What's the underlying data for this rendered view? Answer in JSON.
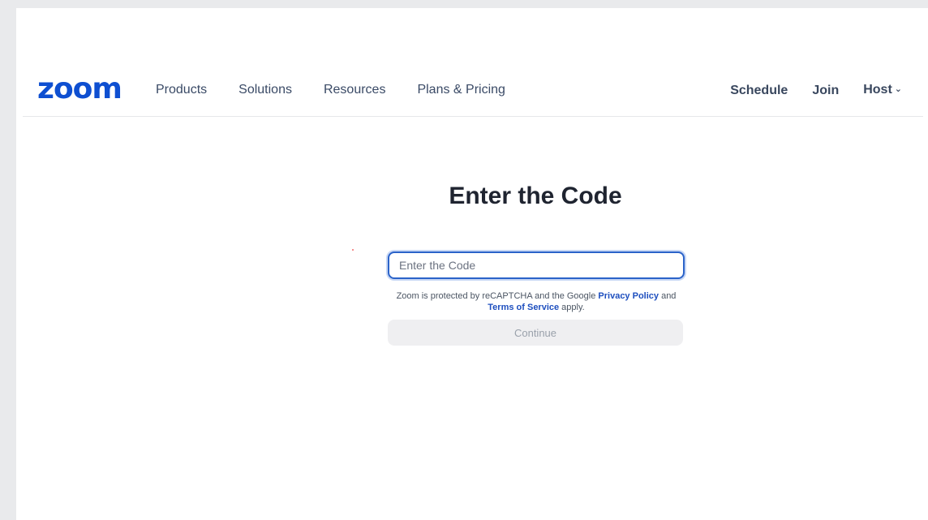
{
  "brand": {
    "logo_text": "zoom",
    "color": "#0e4fd1"
  },
  "nav": {
    "left": [
      "Products",
      "Solutions",
      "Resources",
      "Plans & Pricing"
    ],
    "right": {
      "schedule": "Schedule",
      "join": "Join",
      "host": "Host",
      "host_icon": "chevron-down-icon"
    }
  },
  "main": {
    "title": "Enter the Code",
    "input_placeholder": "Enter the Code",
    "input_value": "",
    "recaptcha": {
      "text_before": "Zoom is protected by reCAPTCHA and the Google ",
      "privacy_link": "Privacy Policy",
      "and_text": " and ",
      "terms_link": "Terms of Service",
      "text_after": " apply."
    },
    "continue_label": "Continue"
  },
  "colors": {
    "link": "#1e4fbf",
    "input_focus_border": "#2b63c9",
    "disabled_button_bg": "#efeff1"
  }
}
